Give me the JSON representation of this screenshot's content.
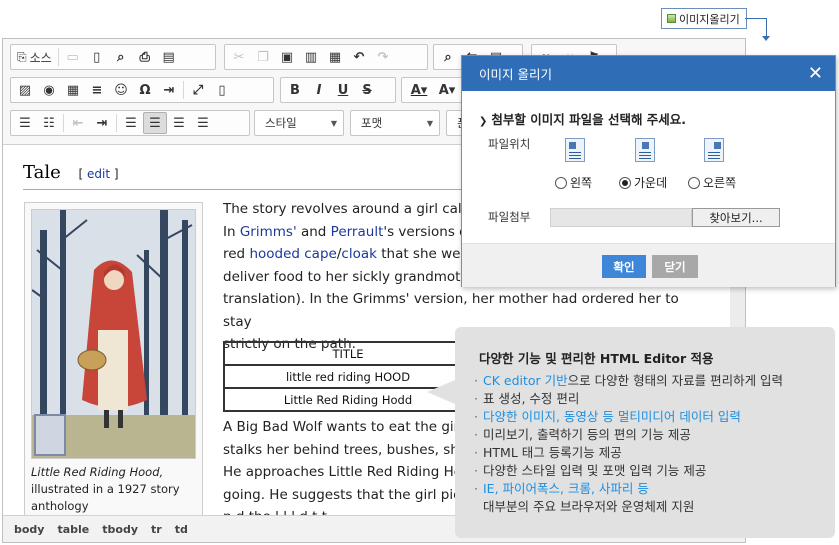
{
  "upload_button": {
    "label": "이미지올리기"
  },
  "toolbar": {
    "source_label": "소스",
    "style_combo": "스타일",
    "format_combo": "포맷",
    "font_combo": "폰"
  },
  "article": {
    "heading": "Tale",
    "edit_open": "[",
    "edit_link": "edit",
    "edit_close": "]",
    "caption_italic": "Little Red Riding Hood,",
    "caption_rest": "illustrated in a 1927 story anthology",
    "p1": {
      "t1": "The story revolves around a girl called",
      "t2": "In",
      "link_grimms": "Grimms'",
      "t3": "and",
      "link_perrault": "Perrault",
      "t4": "'s versions of",
      "t5": "red",
      "link_cape": "hooded cape",
      "t6": "/",
      "link_cloak": "cloak",
      "t7": "that she wear",
      "line4": "deliver food to her sickly grandmothe",
      "line5": "translation). In the Grimms' version, her mother had ordered her to stay",
      "line6": "strictly on the path."
    },
    "table": [
      "TITLE",
      "little red riding HOOD",
      "Little Red  Riding Hodd"
    ],
    "p2": {
      "line1": "A Big Bad Wolf wants to eat the girl",
      "line2": "stalks her behind trees, bushes, shru",
      "line3": "He approaches Little Red Riding Hoo",
      "line4": "going. He suggests that the girl pick",
      "line5": "         n    d    the     l  l    l   d    t  t"
    }
  },
  "statusbar": [
    "body",
    "table",
    "tbody",
    "tr",
    "td"
  ],
  "dialog": {
    "title": "이미지 올리기",
    "question": "첨부할 이미지 파일을 선택해 주세요.",
    "position_label": "파일위치",
    "align_options": [
      "왼쪽",
      "가운데",
      "오른쪽"
    ],
    "selected_align": "가운데",
    "attach_label": "파일첨부",
    "browse_label": "찾아보기...",
    "ok_label": "확인",
    "cancel_label": "닫기"
  },
  "feature_box": {
    "title": "다양한 기능 및 편리한 HTML Editor 적용",
    "items": [
      {
        "hl": "CK editor 기반",
        "rest": "으로 다양한 형태의 자료를 편리하게 입력"
      },
      {
        "hl": "",
        "rest": "표 생성, 수정 편리"
      },
      {
        "hl": "다양한 이미지, 동영상 등 멀티미디어 데이터 입력",
        "rest": ""
      },
      {
        "hl": "",
        "rest": "미리보기, 출력하기 등의 편의 기능 제공"
      },
      {
        "hl": "",
        "rest": "HTML 태그 등록기능 제공"
      },
      {
        "hl": "",
        "rest": "다양한 스타일 입력 및 포맷 입력 기능 제공"
      },
      {
        "hl": "IE, 파이어폭스, 크롬, 사파리 등",
        "rest": ""
      }
    ],
    "last_line": "대부분의 주요 브라우저와 운영체제 지원"
  },
  "colors": {
    "dialog_header": "#2f6eb6",
    "ok_button": "#3e86d8",
    "highlight": "#1e8fe0",
    "link": "#1a3a9a"
  }
}
